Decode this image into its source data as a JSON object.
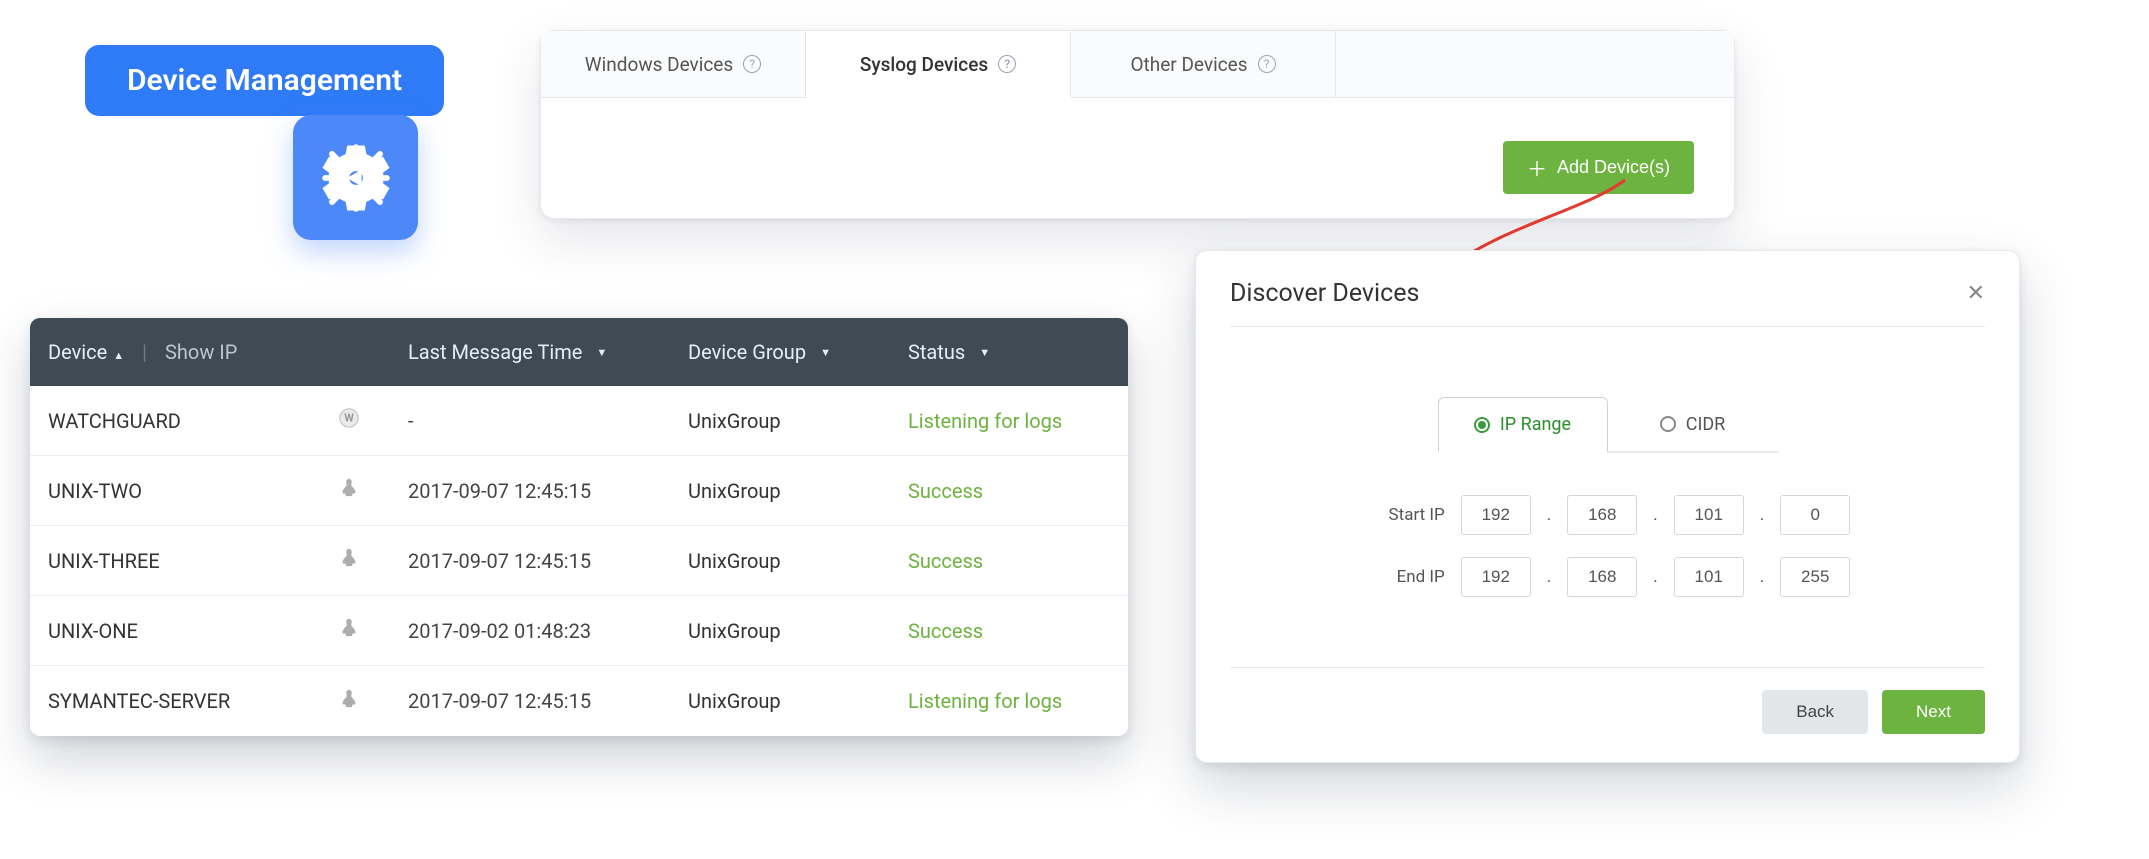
{
  "pill": {
    "label": "Device Management"
  },
  "tabs": [
    {
      "label": "Windows Devices",
      "active": false
    },
    {
      "label": "Syslog Devices",
      "active": true
    },
    {
      "label": "Other Devices",
      "active": false
    }
  ],
  "add_button": "Add Device(s)",
  "table": {
    "columns": {
      "device": "Device",
      "show_ip": "Show IP",
      "last_message_time": "Last Message Time",
      "device_group": "Device Group",
      "status": "Status"
    },
    "rows": [
      {
        "device": "WATCHGUARD",
        "icon": "watchguard",
        "lmt": "-",
        "group": "UnixGroup",
        "status": "Listening for logs"
      },
      {
        "device": "UNIX-TWO",
        "icon": "linux",
        "lmt": "2017-09-07 12:45:15",
        "group": "UnixGroup",
        "status": "Success"
      },
      {
        "device": "UNIX-THREE",
        "icon": "linux",
        "lmt": "2017-09-07 12:45:15",
        "group": "UnixGroup",
        "status": "Success"
      },
      {
        "device": "UNIX-ONE",
        "icon": "linux",
        "lmt": "2017-09-02 01:48:23",
        "group": "UnixGroup",
        "status": "Success"
      },
      {
        "device": "SYMANTEC-SERVER",
        "icon": "linux",
        "lmt": "2017-09-07 12:45:15",
        "group": "UnixGroup",
        "status": "Listening for logs"
      }
    ]
  },
  "dialog": {
    "title": "Discover Devices",
    "modes": {
      "ip_range": "IP Range",
      "cidr": "CIDR"
    },
    "labels": {
      "start_ip": "Start IP",
      "end_ip": "End IP"
    },
    "start_ip": [
      "192",
      "168",
      "101",
      "0"
    ],
    "end_ip": [
      "192",
      "168",
      "101",
      "255"
    ],
    "back": "Back",
    "next": "Next"
  }
}
